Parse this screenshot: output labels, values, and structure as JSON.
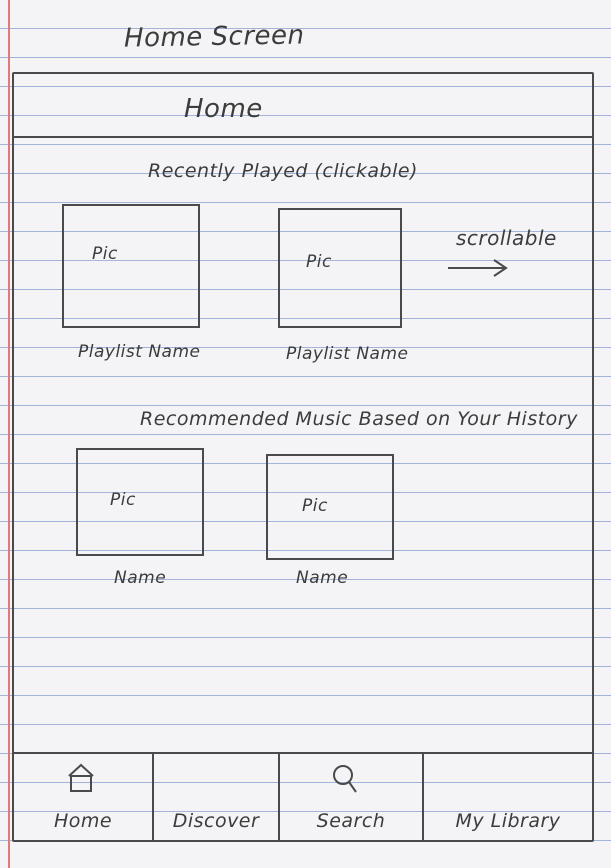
{
  "sheet_title": "Home Screen",
  "header": {
    "title": "Home"
  },
  "recently_played": {
    "heading": "Recently Played (clickable)",
    "scroll_hint": "scrollable",
    "items": [
      {
        "pic": "Pic",
        "name": "Playlist Name"
      },
      {
        "pic": "Pic",
        "name": "Playlist Name"
      }
    ]
  },
  "recommended": {
    "heading": "Recommended Music Based on Your History",
    "items": [
      {
        "pic": "Pic",
        "name": "Name"
      },
      {
        "pic": "Pic",
        "name": "Name"
      }
    ]
  },
  "navbar": {
    "items": [
      {
        "label": "Home",
        "icon": "home-icon"
      },
      {
        "label": "Discover",
        "icon": ""
      },
      {
        "label": "Search",
        "icon": "search-icon"
      },
      {
        "label": "My Library",
        "icon": ""
      }
    ]
  },
  "colors": {
    "paper": "#f4f4f6",
    "ruled_line": "#9fb4d8",
    "margin_line": "#e07a7a",
    "pencil": "#4a4a4a"
  }
}
